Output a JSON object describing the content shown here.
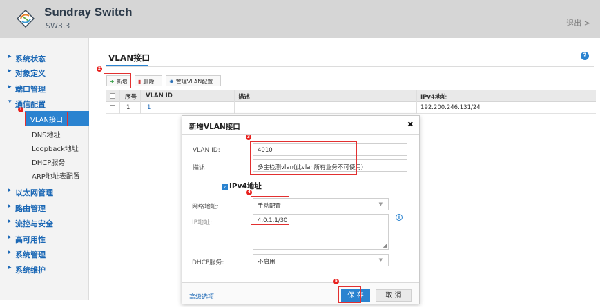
{
  "header": {
    "brand": "Sundray Switch",
    "version": "SW3.3",
    "logout": "退出 >"
  },
  "sidebar": {
    "items": [
      {
        "label": "系统状态"
      },
      {
        "label": "对象定义"
      },
      {
        "label": "端口管理"
      },
      {
        "label": "通信配置"
      },
      {
        "label": "以太网管理"
      },
      {
        "label": "路由管理"
      },
      {
        "label": "流控与安全"
      },
      {
        "label": "高可用性"
      },
      {
        "label": "系统管理"
      },
      {
        "label": "系统维护"
      }
    ],
    "sub_items": [
      {
        "label": "VLAN接口"
      },
      {
        "label": "DNS地址"
      },
      {
        "label": "Loopback地址"
      },
      {
        "label": "DHCP服务"
      },
      {
        "label": "ARP地址表配置"
      }
    ]
  },
  "main": {
    "tab_title": "VLAN接口",
    "toolbar": {
      "add_label": "新增",
      "delete_label": "删除",
      "manage_label": "管理VLAN配置"
    },
    "table": {
      "headers": [
        "序号",
        "VLAN ID",
        "描述",
        "IPv4地址"
      ],
      "rows": [
        {
          "index": "1",
          "vlan_id": "1",
          "desc": "",
          "ipv4": "192.200.246.131/24"
        }
      ]
    }
  },
  "dialog": {
    "title": "新增VLAN接口",
    "vlan_id_label": "VLAN ID:",
    "vlan_id_value": "4010",
    "desc_label": "描述:",
    "desc_value": "多主检测vlan(此vlan所有业务不可使用)",
    "ipv4_group_title": "IPv4地址",
    "net_addr_label": "网络地址:",
    "net_addr_value": "手动配置",
    "ip_label": "IP地址:",
    "ip_value": "4.0.1.1/30",
    "dhcp_label": "DHCP服务:",
    "dhcp_value": "不启用",
    "advanced_link": "高级选项",
    "save_label": "保 存",
    "cancel_label": "取 消"
  },
  "steps": [
    "1",
    "2",
    "3",
    "4",
    "5"
  ],
  "icons": {
    "logo": "sundray-logo-icon",
    "help": "help-icon",
    "info": "info-icon",
    "close": "close-icon"
  },
  "colors": {
    "accent": "#2a83d0",
    "nav_text": "#1a67b5",
    "annotation_red": "#e23030"
  }
}
